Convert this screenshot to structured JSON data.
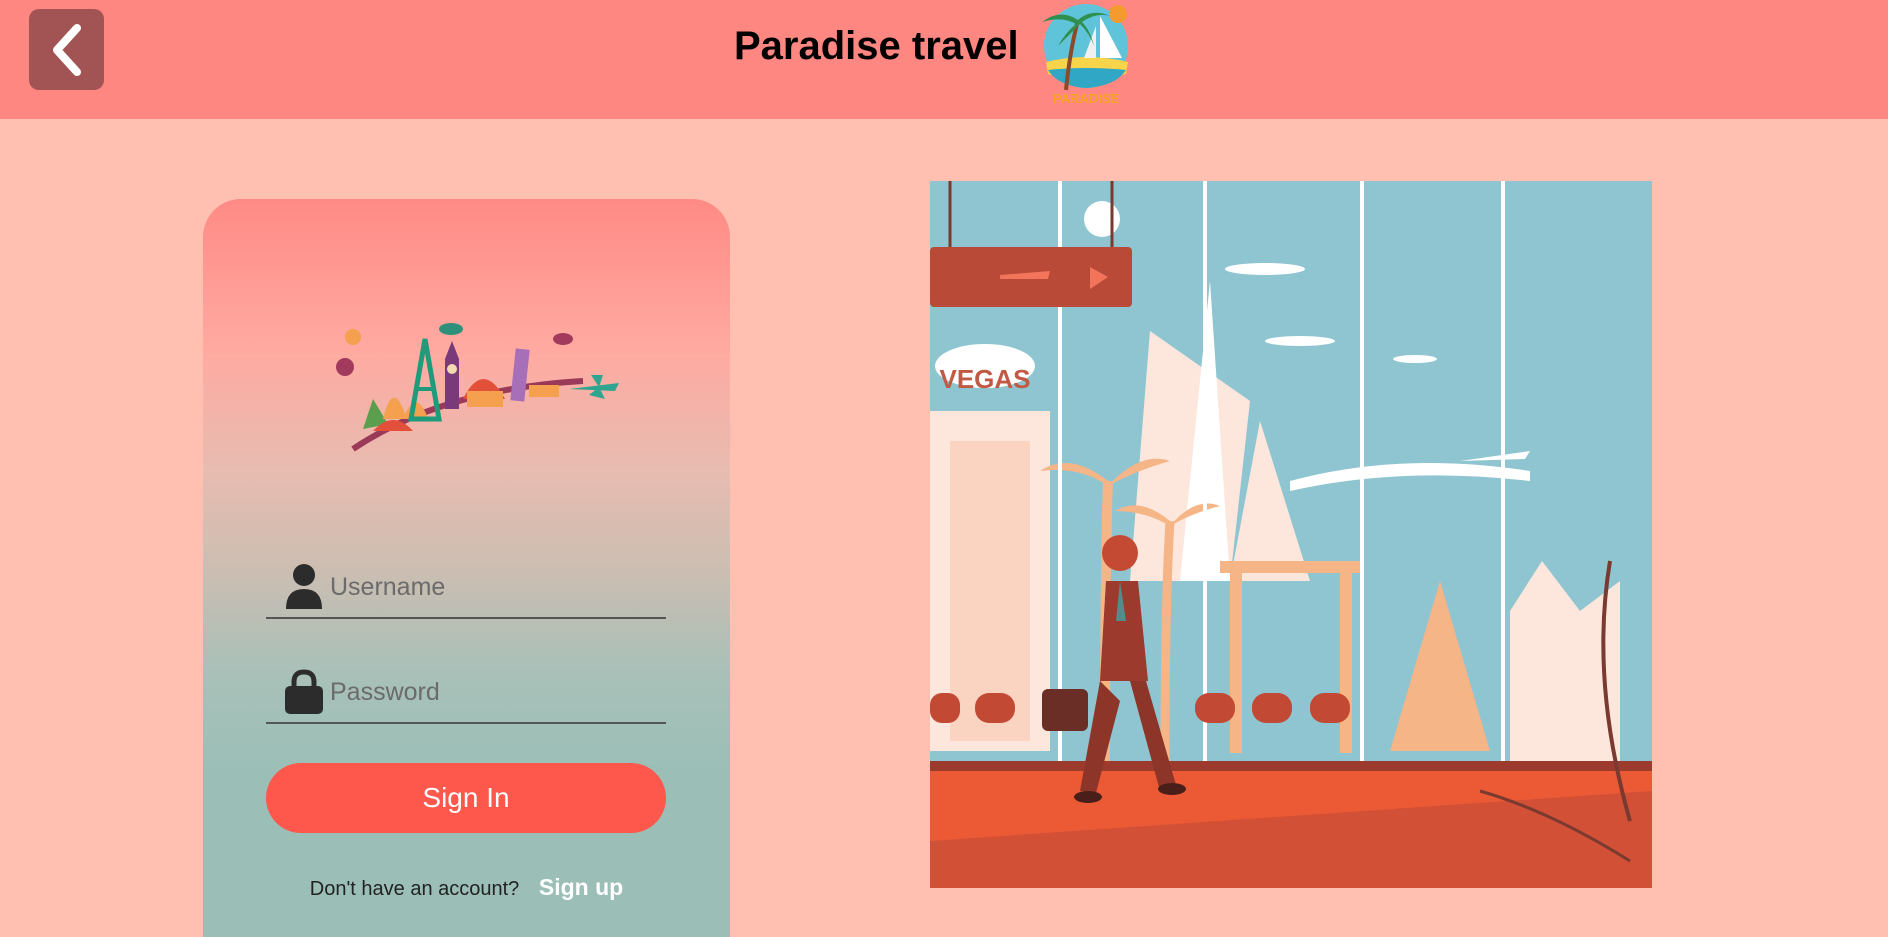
{
  "header": {
    "title": "Paradise travel",
    "logo_text": "PARADISE"
  },
  "login": {
    "username_placeholder": "Username",
    "password_placeholder": "Password",
    "signin_label": "Sign In",
    "no_account_text": "Don't have an account?",
    "signup_label": "Sign up"
  },
  "hero": {
    "sign_text": "VEGAS"
  },
  "colors": {
    "header_bg": "#ff8782",
    "page_bg": "#ffbfb1",
    "button": "#fe574b",
    "back_button": "#a25353"
  }
}
